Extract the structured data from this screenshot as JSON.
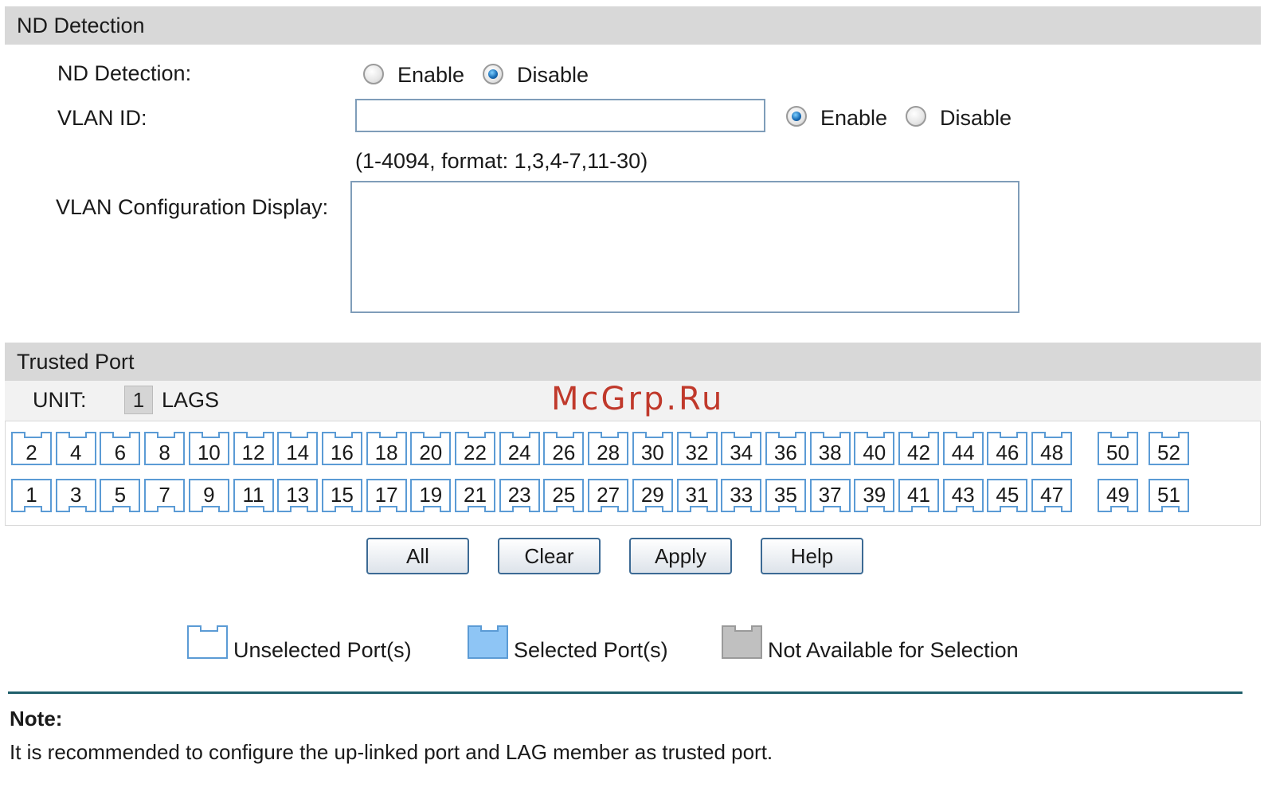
{
  "nd_section": {
    "title": "ND Detection",
    "nd_detection_label": "ND Detection:",
    "enable_label": "Enable",
    "disable_label": "Disable",
    "selected": "Disable",
    "vlan_id_label": "VLAN ID:",
    "vlan_id_value": "",
    "vlan_enable_label": "Enable",
    "vlan_disable_label": "Disable",
    "vlan_selected": "Enable",
    "vlan_hint": "(1-4094, format: 1,3,4-7,11-30)",
    "vlan_display_label": "VLAN Configuration Display:",
    "vlan_display_value": ""
  },
  "trusted_port": {
    "title": "Trusted Port",
    "unit_label": "UNIT:",
    "unit_value": "1",
    "lags_label": "LAGS",
    "watermark": "McGrp.Ru",
    "top_ports": [
      "2",
      "4",
      "6",
      "8",
      "10",
      "12",
      "14",
      "16",
      "18",
      "20",
      "22",
      "24",
      "26",
      "28",
      "30",
      "32",
      "34",
      "36",
      "38",
      "40",
      "42",
      "44",
      "46",
      "48",
      "50",
      "52"
    ],
    "bottom_ports": [
      "1",
      "3",
      "5",
      "7",
      "9",
      "11",
      "13",
      "15",
      "17",
      "19",
      "21",
      "23",
      "25",
      "27",
      "29",
      "31",
      "33",
      "35",
      "37",
      "39",
      "41",
      "43",
      "45",
      "47",
      "49",
      "51"
    ]
  },
  "buttons": {
    "all": "All",
    "clear": "Clear",
    "apply": "Apply",
    "help": "Help"
  },
  "legend": {
    "unselected": "Unselected Port(s)",
    "selected": "Selected Port(s)",
    "not_available": "Not Available for Selection",
    "colors": {
      "unselected": "#ffffff",
      "selected": "#8ec5f5",
      "not_available": "#c0c0c0",
      "border": "#5b9bd5"
    }
  },
  "note": {
    "title": "Note:",
    "text": "It is recommended to configure the up-linked port and LAG member as trusted port."
  }
}
